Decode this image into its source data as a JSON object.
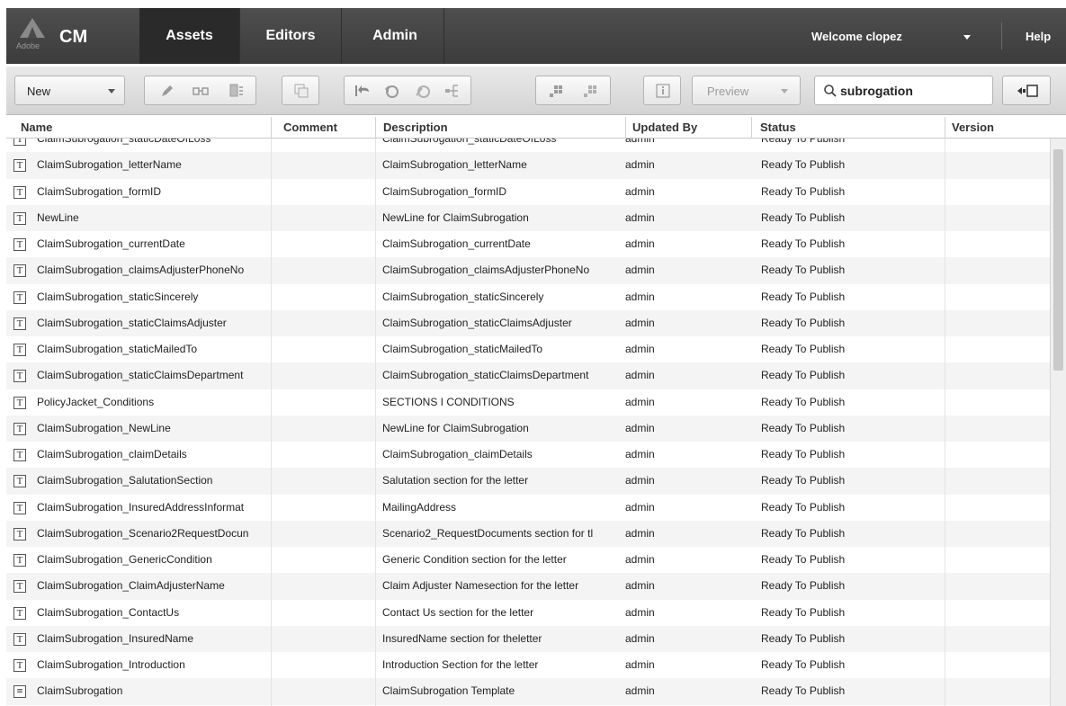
{
  "app": {
    "logo_text": "Adobe",
    "name": "CM",
    "tabs": [
      "Assets",
      "Editors",
      "Admin"
    ],
    "active_tab": "Assets",
    "welcome": "Welcome clopez",
    "help": "Help"
  },
  "toolbar": {
    "new_label": "New",
    "preview_label": "Preview",
    "search_value": "subrogation",
    "icons": [
      "edit-icon",
      "glasses-icon",
      "copy-icon",
      "duplicate-icon",
      "revert-icon",
      "publish-icon",
      "unpublish-icon",
      "tree-icon",
      "group-icon",
      "ungroup-icon",
      "info-icon",
      "search-icon",
      "collapse-panel-icon"
    ]
  },
  "table": {
    "columns": [
      "Name",
      "Comment",
      "Description",
      "Updated By",
      "Status",
      "Version"
    ],
    "rows": [
      {
        "icon": "T",
        "name": "ClaimSubrogation_staticDateOfLoss",
        "comment": "",
        "description": "ClaimSubrogation_staticDateOfLoss",
        "updated_by": "admin",
        "status": "Ready To Publish",
        "version": ""
      },
      {
        "icon": "T",
        "name": "ClaimSubrogation_letterName",
        "comment": "",
        "description": "ClaimSubrogation_letterName",
        "updated_by": "admin",
        "status": "Ready To Publish",
        "version": ""
      },
      {
        "icon": "T",
        "name": "ClaimSubrogation_formID",
        "comment": "",
        "description": "ClaimSubrogation_formID",
        "updated_by": "admin",
        "status": "Ready To Publish",
        "version": ""
      },
      {
        "icon": "T",
        "name": "NewLine",
        "comment": "",
        "description": "NewLine for ClaimSubrogation",
        "updated_by": "admin",
        "status": "Ready To Publish",
        "version": ""
      },
      {
        "icon": "T",
        "name": "ClaimSubrogation_currentDate",
        "comment": "",
        "description": "ClaimSubrogation_currentDate",
        "updated_by": "admin",
        "status": "Ready To Publish",
        "version": ""
      },
      {
        "icon": "T",
        "name": "ClaimSubrogation_claimsAdjusterPhoneNo",
        "comment": "",
        "description": "ClaimSubrogation_claimsAdjusterPhoneNo",
        "updated_by": "admin",
        "status": "Ready To Publish",
        "version": ""
      },
      {
        "icon": "T",
        "name": "ClaimSubrogation_staticSincerely",
        "comment": "",
        "description": "ClaimSubrogation_staticSincerely",
        "updated_by": "admin",
        "status": "Ready To Publish",
        "version": ""
      },
      {
        "icon": "T",
        "name": "ClaimSubrogation_staticClaimsAdjuster",
        "comment": "",
        "description": "ClaimSubrogation_staticClaimsAdjuster",
        "updated_by": "admin",
        "status": "Ready To Publish",
        "version": ""
      },
      {
        "icon": "T",
        "name": "ClaimSubrogation_staticMailedTo",
        "comment": "",
        "description": "ClaimSubrogation_staticMailedTo",
        "updated_by": "admin",
        "status": "Ready To Publish",
        "version": ""
      },
      {
        "icon": "T",
        "name": "ClaimSubrogation_staticClaimsDepartment",
        "comment": "",
        "description": "ClaimSubrogation_staticClaimsDepartment",
        "updated_by": "admin",
        "status": "Ready To Publish",
        "version": ""
      },
      {
        "icon": "T",
        "name": "PolicyJacket_Conditions",
        "comment": "",
        "description": "SECTIONS I CONDITIONS",
        "updated_by": "admin",
        "status": "Ready To Publish",
        "version": ""
      },
      {
        "icon": "T",
        "name": "ClaimSubrogation_NewLine",
        "comment": "",
        "description": "NewLine for ClaimSubrogation",
        "updated_by": "admin",
        "status": "Ready To Publish",
        "version": ""
      },
      {
        "icon": "T",
        "name": "ClaimSubrogation_claimDetails",
        "comment": "",
        "description": "ClaimSubrogation_claimDetails",
        "updated_by": "admin",
        "status": "Ready To Publish",
        "version": ""
      },
      {
        "icon": "T",
        "name": "ClaimSubrogation_SalutationSection",
        "comment": "",
        "description": "Salutation section for the letter",
        "updated_by": "admin",
        "status": "Ready To Publish",
        "version": ""
      },
      {
        "icon": "T",
        "name": "ClaimSubrogation_InsuredAddressInformat",
        "comment": "",
        "description": "MailingAddress",
        "updated_by": "admin",
        "status": "Ready To Publish",
        "version": ""
      },
      {
        "icon": "T",
        "name": "ClaimSubrogation_Scenario2RequestDocun",
        "comment": "",
        "description": "Scenario2_RequestDocuments section for tl",
        "updated_by": "admin",
        "status": "Ready To Publish",
        "version": ""
      },
      {
        "icon": "T",
        "name": "ClaimSubrogation_GenericCondition",
        "comment": "",
        "description": "Generic Condition section for the letter",
        "updated_by": "admin",
        "status": "Ready To Publish",
        "version": ""
      },
      {
        "icon": "T",
        "name": "ClaimSubrogation_ClaimAdjusterName",
        "comment": "",
        "description": "Claim Adjuster Namesection for the letter",
        "updated_by": "admin",
        "status": "Ready To Publish",
        "version": ""
      },
      {
        "icon": "T",
        "name": "ClaimSubrogation_ContactUs",
        "comment": "",
        "description": "Contact Us section for the letter",
        "updated_by": "admin",
        "status": "Ready To Publish",
        "version": ""
      },
      {
        "icon": "T",
        "name": "ClaimSubrogation_InsuredName",
        "comment": "",
        "description": "InsuredName section for theletter",
        "updated_by": "admin",
        "status": "Ready To Publish",
        "version": ""
      },
      {
        "icon": "T",
        "name": "ClaimSubrogation_Introduction",
        "comment": "",
        "description": "Introduction Section for the letter",
        "updated_by": "admin",
        "status": "Ready To Publish",
        "version": ""
      },
      {
        "icon": "doc",
        "name": "ClaimSubrogation",
        "comment": "",
        "description": "ClaimSubrogation Template",
        "updated_by": "admin",
        "status": "Ready To Publish",
        "version": ""
      }
    ]
  },
  "colors": {
    "nav_bg": "#444444",
    "nav_active": "#2a2a2a",
    "toolbar_bg": "#dcdcdc",
    "row_alt": "#f4f4f4"
  }
}
